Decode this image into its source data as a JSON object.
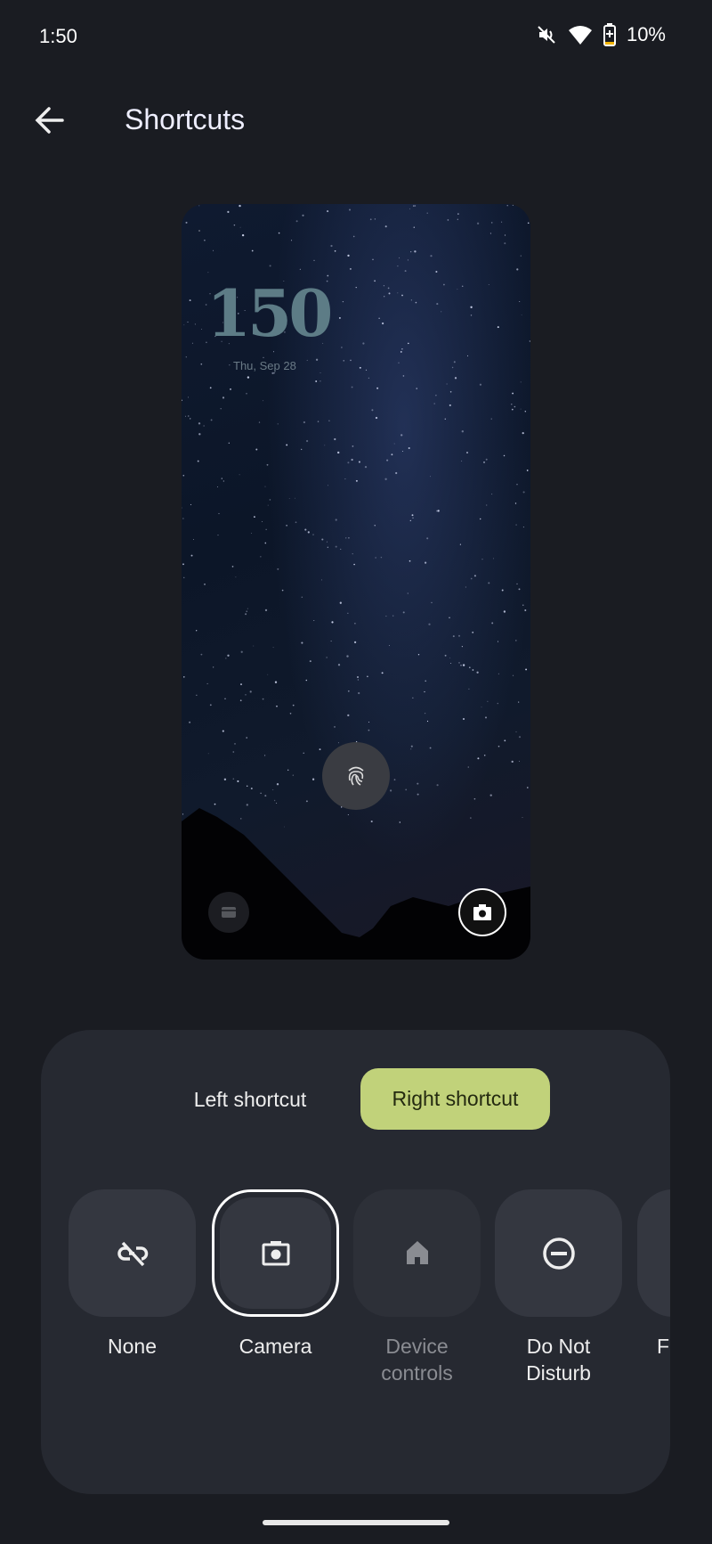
{
  "status_bar": {
    "time": "1:50",
    "battery": "10%",
    "icons": [
      "mute-icon",
      "wifi-icon",
      "battery-charging-icon"
    ]
  },
  "header": {
    "title": "Shortcuts",
    "back_icon": "arrow-back-icon"
  },
  "preview": {
    "clock": "150",
    "date": "Thu, Sep 28",
    "left_shortcut_icon": "wallet-icon",
    "right_shortcut_icon": "camera-icon",
    "center_icon": "fingerprint-icon"
  },
  "sheet": {
    "tabs": [
      {
        "label": "Left shortcut",
        "selected": false
      },
      {
        "label": "Right shortcut",
        "selected": true
      }
    ],
    "accent": "#c1d27a",
    "options": [
      {
        "label": "None",
        "icon": "link-off-icon",
        "selected": false
      },
      {
        "label": "Camera",
        "icon": "camera-icon",
        "selected": true
      },
      {
        "label": "Device controls",
        "line1": "Device",
        "line2": "controls",
        "icon": "home-icon",
        "disabled": true
      },
      {
        "label": "Do Not Disturb",
        "line1": "Do Not",
        "line2": "Disturb",
        "icon": "do-not-disturb-icon"
      },
      {
        "label": "Fl",
        "icon": "unknown-icon"
      }
    ]
  }
}
